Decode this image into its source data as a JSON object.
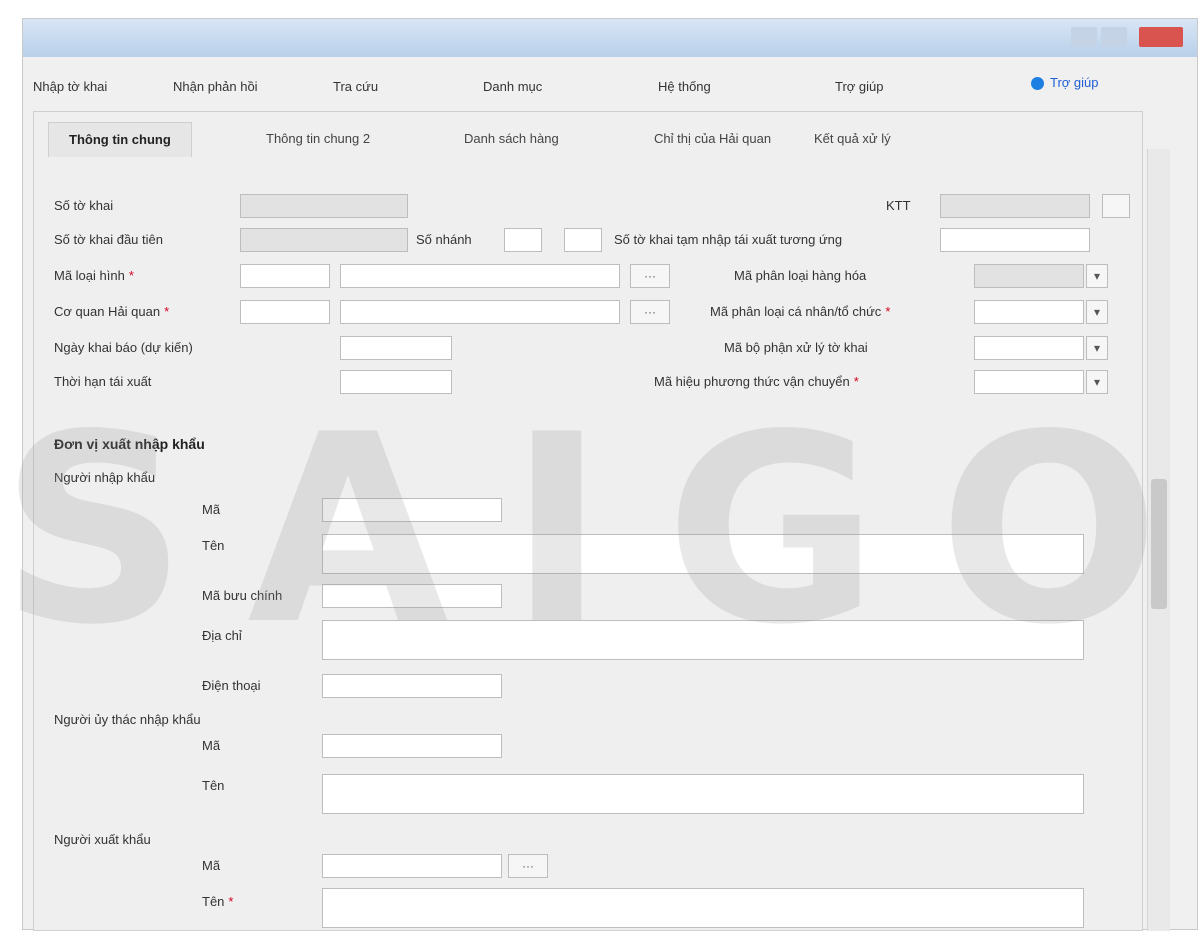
{
  "window": {
    "controls": {
      "minimize": "—",
      "maximize": "☐",
      "close": "✕"
    }
  },
  "ribbon": {
    "tabs": [
      "Nhập tờ khai",
      "Nhận phản hồi",
      "Tra cứu",
      "Danh mục",
      "Hệ thống",
      "Trợ giúp"
    ],
    "help_label": "Trợ giúp"
  },
  "form_tabs": [
    "Thông tin chung",
    "Thông tin chung 2",
    "Danh sách hàng",
    "Chỉ thị của Hải quan",
    "Kết quả xử lý"
  ],
  "fields": {
    "so_to_khai": {
      "label": "Số tờ khai",
      "value": ""
    },
    "so_to_khai_dau_tien": {
      "label": "Số tờ khai đầu tiên",
      "value": ""
    },
    "so_nhanh": {
      "label": "Số nhánh",
      "value": ""
    },
    "ma_loai_hinh": {
      "label": "Mã loại hình",
      "value": ""
    },
    "co_quan_hai_quan": {
      "label": "Cơ quan Hải quan",
      "code": "",
      "name": ""
    },
    "ngay_khai_bao": {
      "label": "Ngày khai báo (dự kiến)",
      "value": ""
    },
    "thoi_han_tai_xuat": {
      "label": "Thời hạn tái xuất",
      "value": ""
    },
    "tk_tam_nhap": {
      "label": "Số tờ khai tạm nhập tái xuất tương ứng",
      "value": ""
    },
    "ma_phan_loai_hang_hoa": {
      "label": "Mã phân loại hàng hóa",
      "value": ""
    },
    "ma_phan_loai_ca_nhan": {
      "label": "Mã phân loại cá nhân/tổ chức",
      "value": ""
    },
    "ma_bo_phan_xu_ly": {
      "label": "Mã bộ phận xử lý tờ khai",
      "value": ""
    },
    "ma_hieu_phuong_thuc": {
      "label": "Mã hiệu phương thức vận chuyển",
      "value": ""
    }
  },
  "section_title": "Đơn vị xuất nhập khẩu",
  "nguoi_nhap_khau": {
    "label": "Người nhập khẩu",
    "ma": {
      "label": "Mã",
      "value": ""
    },
    "ten": {
      "label": "Tên",
      "value": ""
    },
    "ma_buu_chinh": {
      "label": "Mã bưu chính",
      "value": ""
    },
    "dia_chi": {
      "label": "Địa chỉ",
      "value": ""
    },
    "dien_thoai": {
      "label": "Điện thoại",
      "value": ""
    }
  },
  "nguoi_uy_thac": {
    "label": "Người ủy thác nhập khẩu",
    "ma": {
      "label": "Mã",
      "value": ""
    },
    "ten": {
      "label": "Tên",
      "value": ""
    }
  },
  "nguoi_xuat_khau": {
    "label": "Người xuất khẩu",
    "ma": {
      "label": "Mã",
      "value": ""
    },
    "ten": {
      "label": "Tên",
      "value": ""
    }
  },
  "watermark": "SAIGON"
}
